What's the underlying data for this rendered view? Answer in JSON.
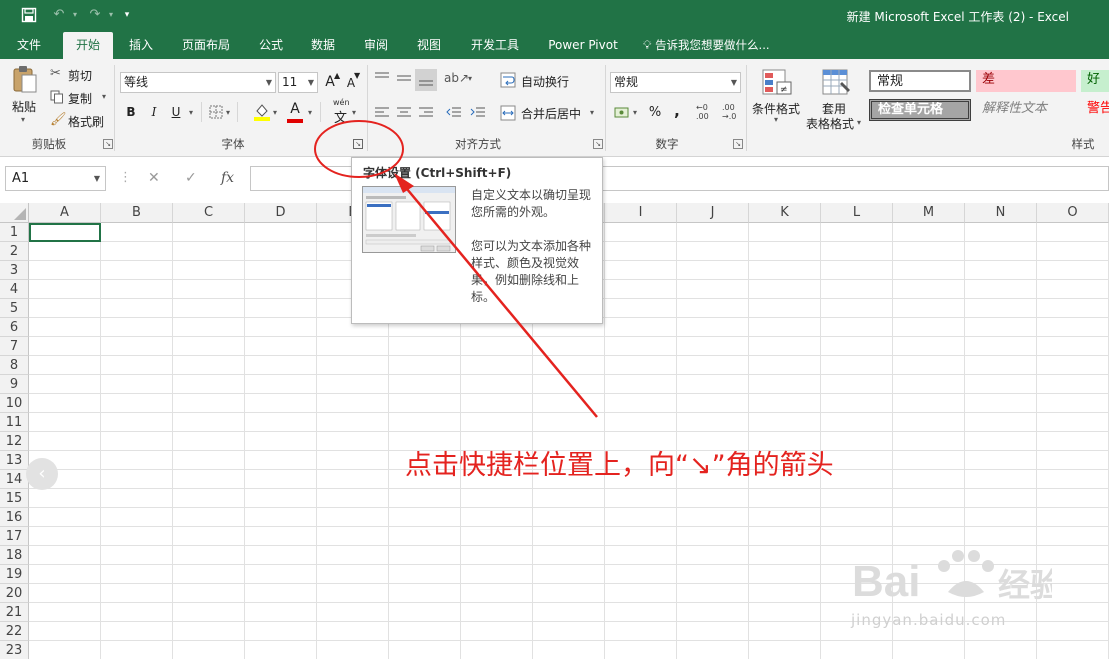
{
  "window": {
    "title": "新建 Microsoft Excel 工作表 (2) - Excel"
  },
  "quick_access": {
    "save_icon": "save-icon",
    "undo_icon": "undo-icon",
    "redo_icon": "redo-icon",
    "customize_icon": "customize-qat-icon"
  },
  "tabs": [
    {
      "label": "文件"
    },
    {
      "label": "开始"
    },
    {
      "label": "插入"
    },
    {
      "label": "页面布局"
    },
    {
      "label": "公式"
    },
    {
      "label": "数据"
    },
    {
      "label": "审阅"
    },
    {
      "label": "视图"
    },
    {
      "label": "开发工具"
    },
    {
      "label": "Power Pivot"
    }
  ],
  "active_tab": "开始",
  "tell_me": "告诉我您想要做什么...",
  "ribbon": {
    "clipboard": {
      "paste": "粘贴",
      "cut": "剪切",
      "copy": "复制",
      "format_painter": "格式刷",
      "group_label": "剪贴板"
    },
    "font": {
      "font_name": "等线",
      "font_size": "11",
      "grow": "A",
      "shrink": "A",
      "bold": "B",
      "italic": "I",
      "underline": "U",
      "font_color": "A",
      "phonetic": "wén",
      "phonetic_char": "文",
      "group_label": "字体"
    },
    "alignment": {
      "wrap_text": "自动换行",
      "merge_center": "合并后居中",
      "group_label": "对齐方式"
    },
    "number": {
      "format": "常规",
      "percent": "%",
      "comma": ",",
      "group_label": "数字"
    },
    "styles": {
      "conditional_formatting": "条件格式",
      "format_as_table_1": "套用",
      "format_as_table_2": "表格格式",
      "gallery": [
        {
          "label": "常规"
        },
        {
          "label": "差"
        },
        {
          "label": "好"
        },
        {
          "label": "检查单元格"
        },
        {
          "label": "解释性文本"
        },
        {
          "label": "警告"
        }
      ],
      "group_label": "样式"
    }
  },
  "formula_bar": {
    "name_box": "A1",
    "cancel": "✕",
    "enter": "✓",
    "fx": "fx",
    "value": ""
  },
  "columns": [
    "A",
    "B",
    "C",
    "D",
    "E",
    "F",
    "G",
    "H",
    "I",
    "J",
    "K",
    "L",
    "M",
    "N",
    "O"
  ],
  "rows": [
    "1",
    "2",
    "3",
    "4",
    "5",
    "6",
    "7",
    "8",
    "9",
    "10",
    "11",
    "12",
    "13",
    "14",
    "15",
    "16",
    "17",
    "18",
    "19",
    "20",
    "21",
    "22",
    "23"
  ],
  "tooltip": {
    "title": "字体设置 (Ctrl+Shift+F)",
    "lines": [
      "自定义文本以确切呈现",
      "您所需的外观。",
      "",
      "您可以为文本添加各种",
      "样式、颜色及视觉效",
      "果，例如删除线和上",
      "标。"
    ]
  },
  "annotation": {
    "text": "点击快捷栏位置上，向“↘”角的箭头"
  },
  "watermark": {
    "brand": "Bai经验",
    "url": "jingyan.baidu.com"
  },
  "colors": {
    "excel_green": "#217346",
    "ribbon_bg": "#f3f3f3",
    "annotation_red": "#e4231f"
  }
}
